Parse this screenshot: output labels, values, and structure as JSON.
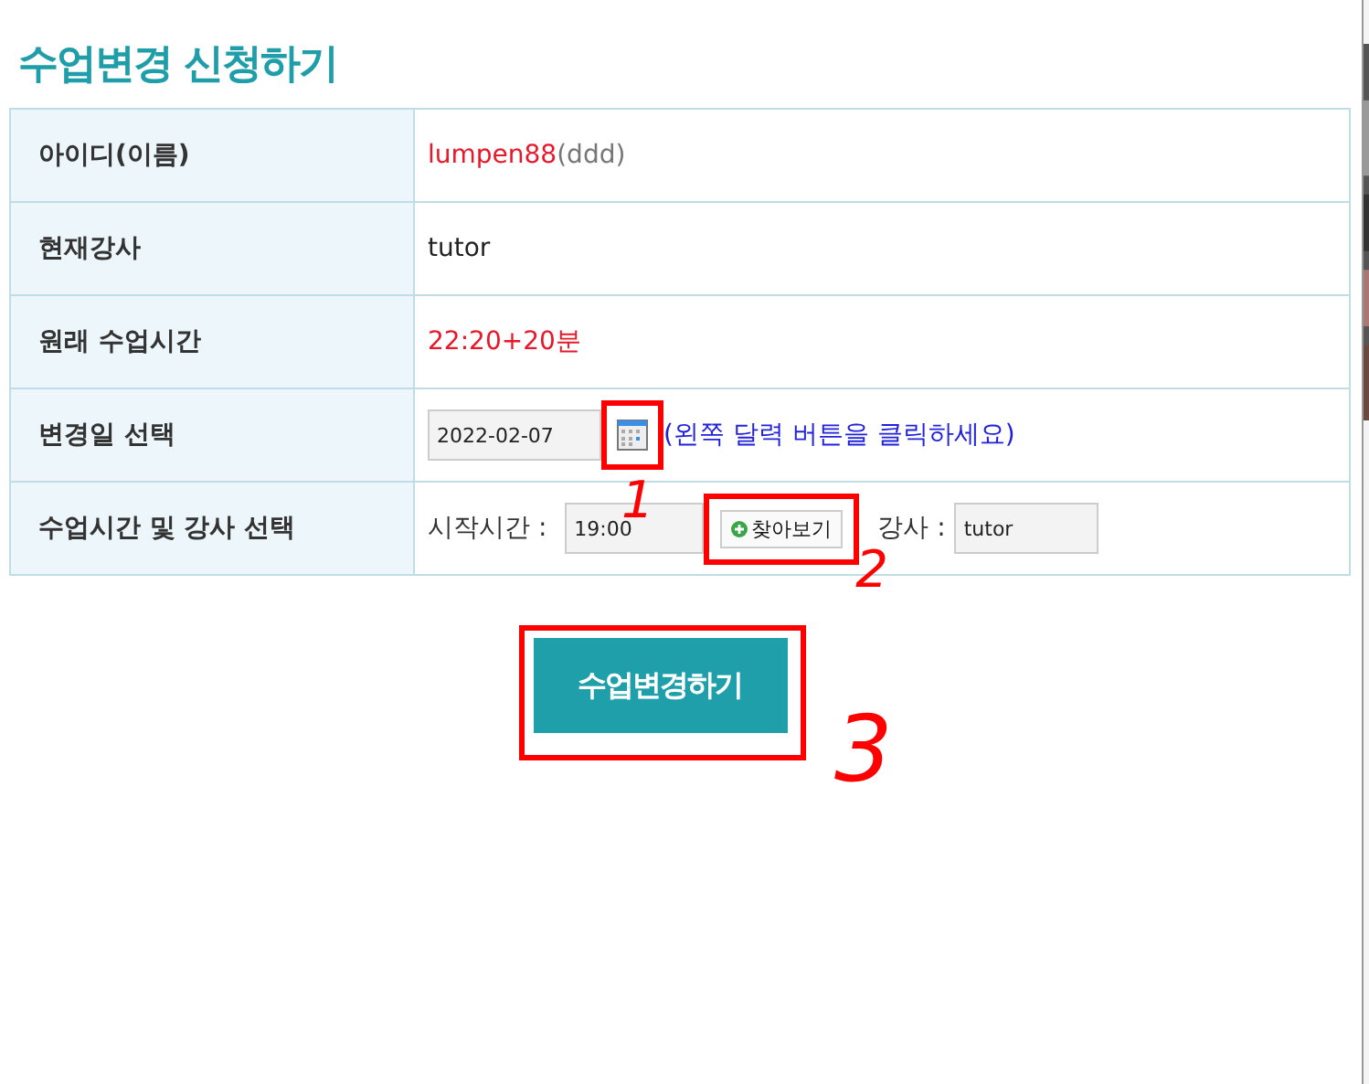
{
  "title": "수업변경 신청하기",
  "rows": [
    {
      "kind": "id",
      "label": "아이디(이름)",
      "value": "lumpen88",
      "extra": "(ddd)"
    },
    {
      "kind": "text",
      "label": "현재강사",
      "value": "tutor"
    },
    {
      "kind": "alert",
      "label": "원래 수업시간",
      "value": "22:20+20분"
    },
    {
      "kind": "date",
      "label": "변경일 선택",
      "value": "2022-02-07",
      "hint": "(왼쪽 달력 버튼을 클릭하세요)",
      "marked": true,
      "mark_label": "1"
    },
    {
      "kind": "time",
      "label": "수업시간 및 강사 선택",
      "time_label": "시작시간 :",
      "value": "19:00",
      "button": "찾아보기",
      "marked": true,
      "mark_label": "2",
      "tutor_label": "강사 :",
      "tutor": "tutor"
    }
  ],
  "submit": {
    "label": "수업변경하기",
    "marked": true,
    "mark_label": "3"
  }
}
